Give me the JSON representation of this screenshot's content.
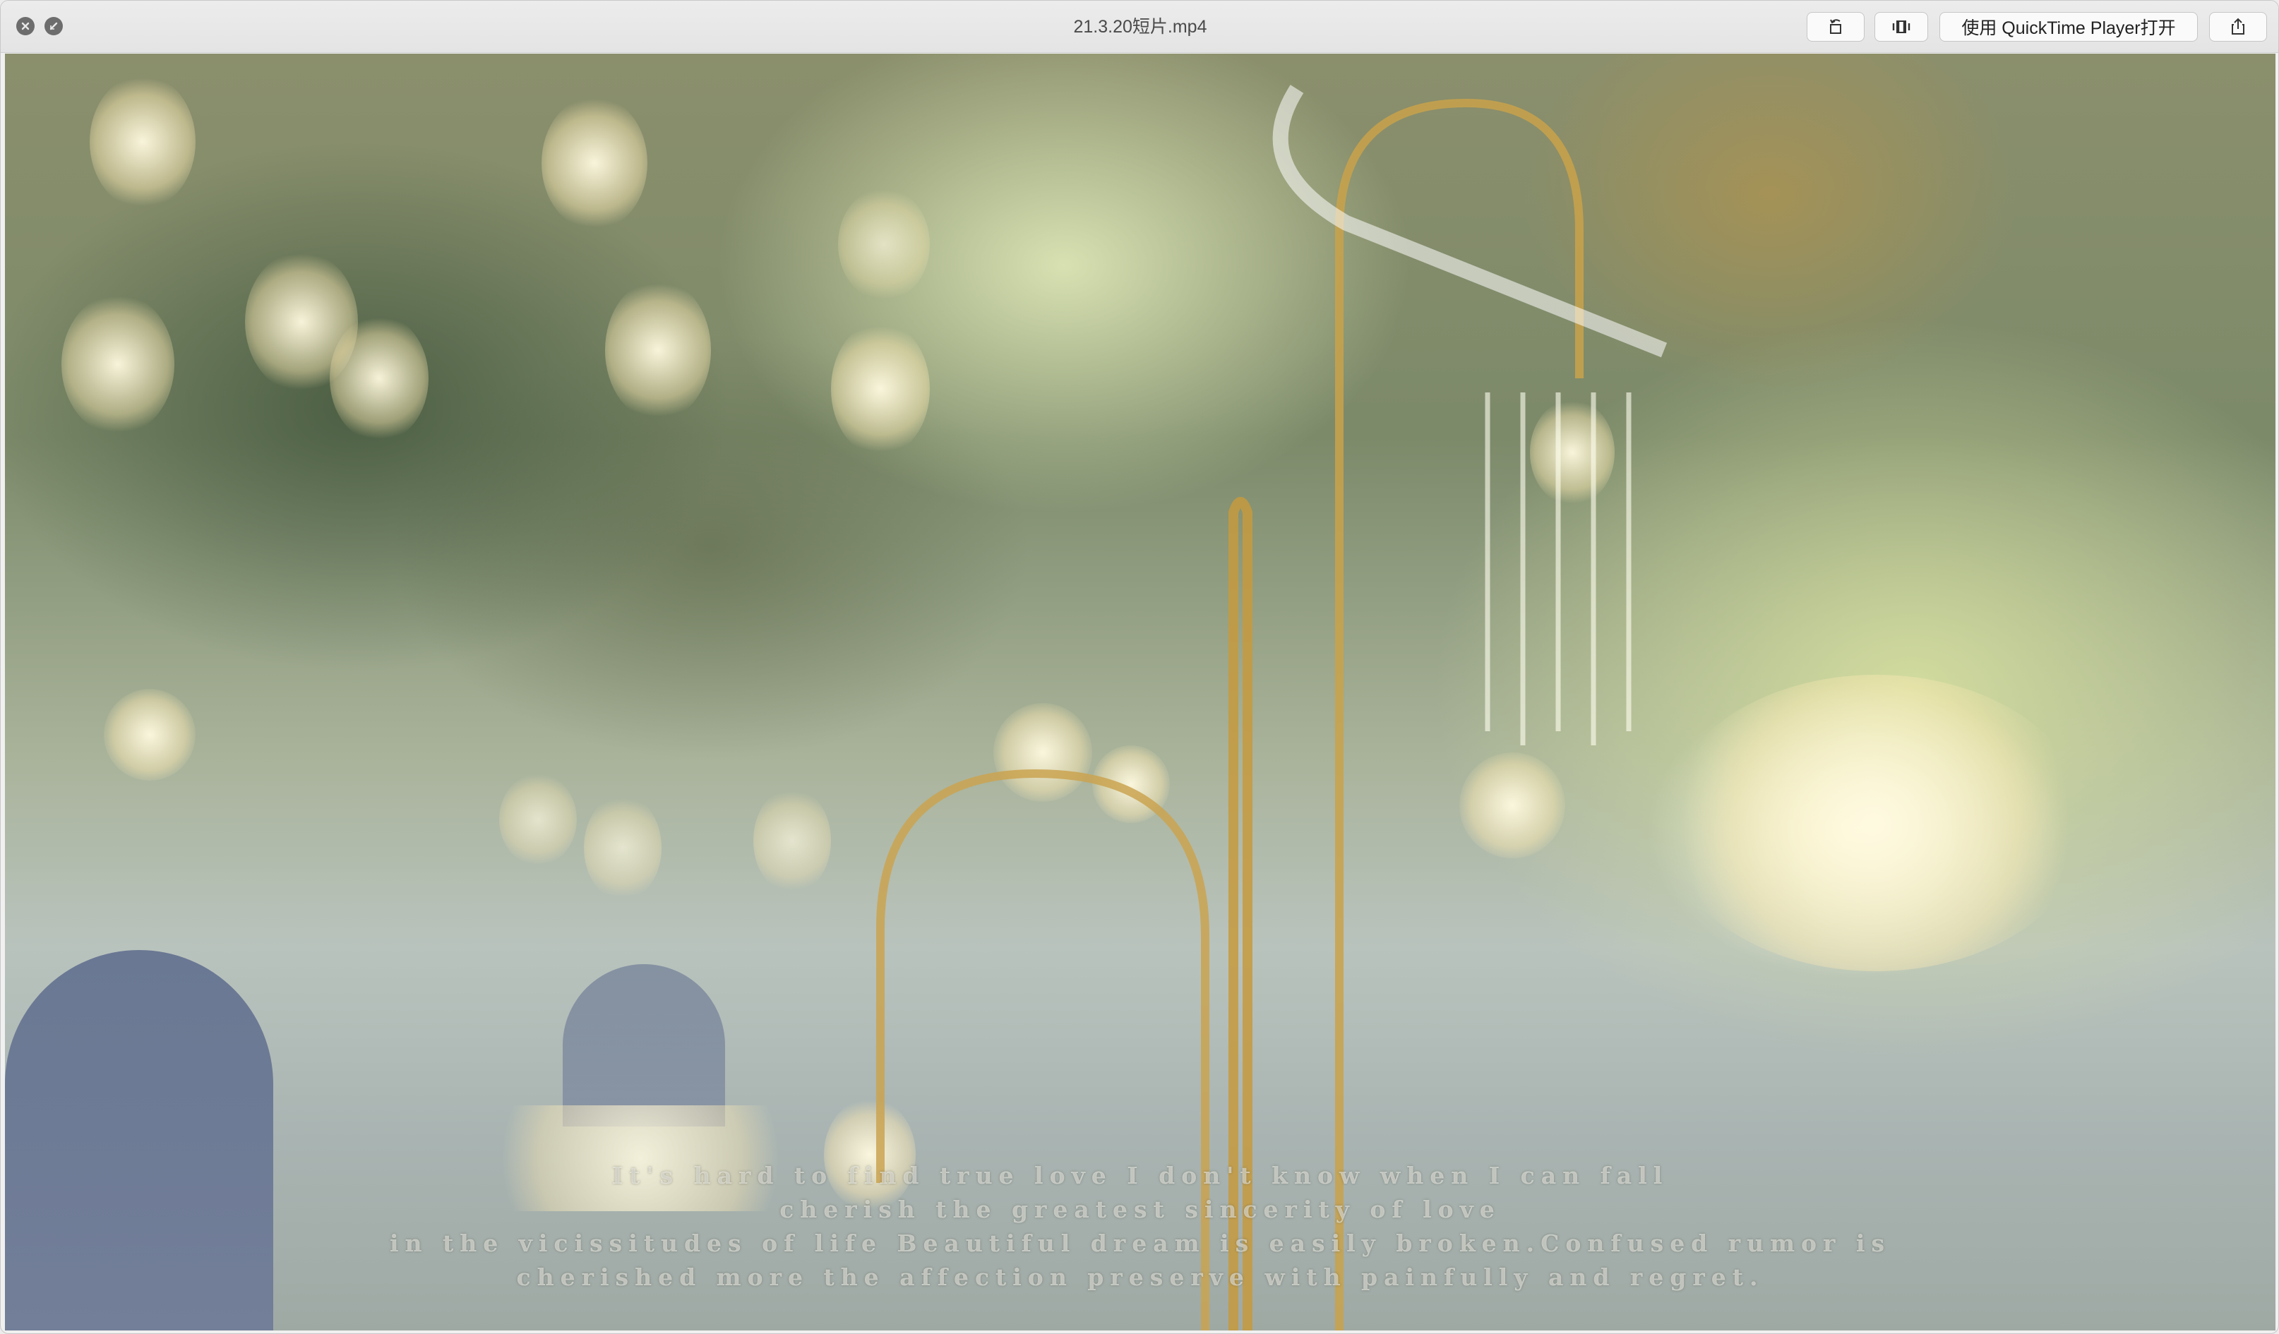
{
  "window": {
    "title": "21.3.20短片.mp4"
  },
  "toolbar": {
    "rotate_icon": "rotate-left-icon",
    "trim_icon": "trim-icon",
    "open_with_label": "使用 QuickTime Player打开",
    "share_icon": "share-icon"
  },
  "video": {
    "subtitles": [
      "It's hard to find true love I don't know when I can fall",
      "cherish the greatest sincerity of love",
      "in the vicissitudes of life Beautiful dream is easily broken.Confused rumor is",
      "cherished more the affection preserve with painfully and regret."
    ]
  },
  "colors": {
    "titlebar": "#e8e8e8",
    "traffic_light": "#6d6d6d"
  }
}
